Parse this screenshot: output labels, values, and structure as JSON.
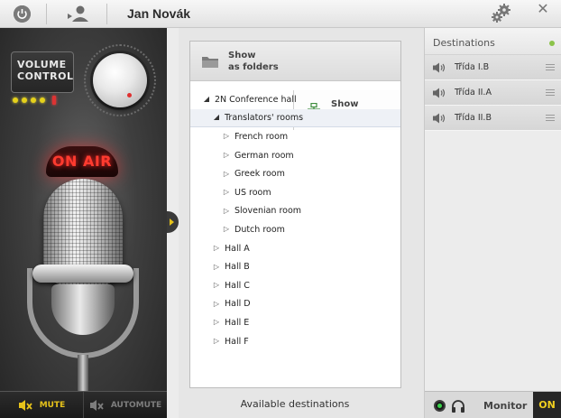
{
  "topbar": {
    "user_name": "Jan Novák"
  },
  "volume": {
    "label": "VOLUME\nCONTROL"
  },
  "onair": {
    "label": "ON AIR"
  },
  "mic_buttons": {
    "mute": "MUTE",
    "automute": "AUTOMUTE"
  },
  "view_toggle": {
    "folders": "Show\nas folders",
    "tree": "Show\nas tree"
  },
  "tree": {
    "root": "2N Conference hall",
    "translators": "Translators' rooms",
    "rooms": [
      "French room",
      "German room",
      "Greek room",
      "US room",
      "Slovenian room",
      "Dutch room"
    ],
    "halls": [
      "Hall A",
      "Hall B",
      "Hall C",
      "Hall D",
      "Hall E",
      "Hall F"
    ]
  },
  "available_label": "Available destinations",
  "destinations": {
    "title": "Destinations",
    "items": [
      "Třída I.B",
      "Třída II.A",
      "Třída II.B"
    ]
  },
  "monitor": {
    "label": "Monitor",
    "state": "ON"
  },
  "colors": {
    "accent": "#e6c21a",
    "onair": "#ff3b2f",
    "status_green": "#8bc34a"
  }
}
